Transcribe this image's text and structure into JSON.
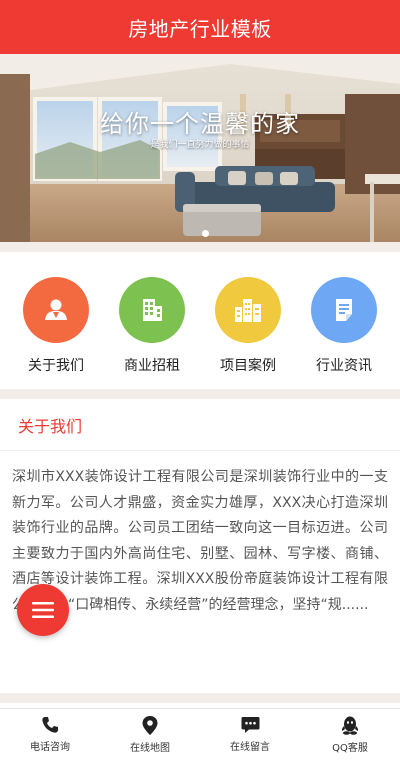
{
  "header": {
    "title": "房地产行业模板"
  },
  "banner": {
    "title": "给你一个温馨的家",
    "subtitle": "是我们一直努力做的事情"
  },
  "nav": {
    "items": [
      {
        "label": "关于我们",
        "icon": "person-icon",
        "color": "#f46a40"
      },
      {
        "label": "商业招租",
        "icon": "buildings-icon",
        "color": "#7dc250"
      },
      {
        "label": "项目案例",
        "icon": "city-icon",
        "color": "#f0c93e"
      },
      {
        "label": "行业资讯",
        "icon": "document-icon",
        "color": "#6ea8f5"
      }
    ]
  },
  "about": {
    "title": "关于我们",
    "text": "深圳市XXX装饰设计工程有限公司是深圳装饰行业中的一支新力军。公司人才鼎盛，资金实力雄厚，XXX决心打造深圳装饰行业的品牌。公司员工团结一致向这一目标迈进。公司主要致力于国内外高尚住宅、别墅、园林、写字楼、商铺、酒店等设计装饰工程。深圳XXX股份帝庭装饰设计工程有限公司秉乘“口碑相传、永续经营”的经营理念，坚持“规......"
  },
  "tabbar": {
    "items": [
      {
        "label": "电话咨询",
        "icon": "phone-icon"
      },
      {
        "label": "在线地图",
        "icon": "map-pin-icon"
      },
      {
        "label": "在线留言",
        "icon": "message-icon"
      },
      {
        "label": "QQ客服",
        "icon": "qq-icon"
      }
    ]
  },
  "colors": {
    "accent": "#ee3a33",
    "section_bg": "#f2ede9"
  }
}
